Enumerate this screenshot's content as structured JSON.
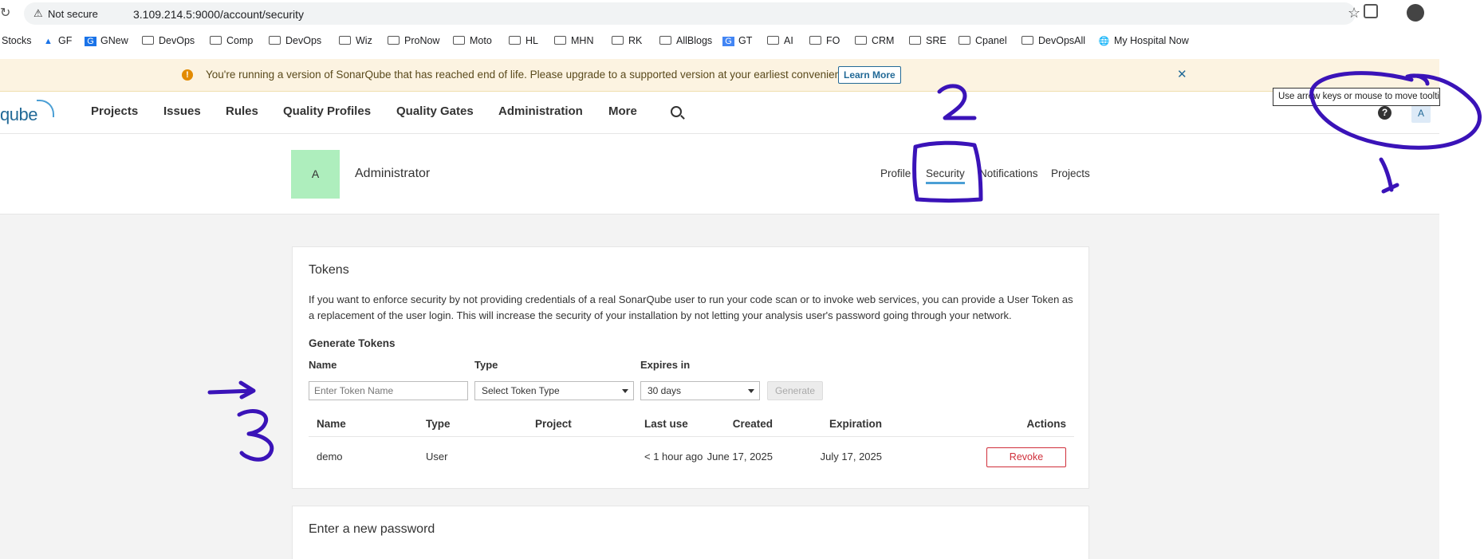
{
  "browser": {
    "not_secure": "Not secure",
    "url": "3.109.214.5:9000/account/security",
    "bookmarks": [
      {
        "label": "Stocks",
        "icon": "none"
      },
      {
        "label": "GF",
        "icon": "drive-icon"
      },
      {
        "label": "GNew",
        "icon": "news-icon"
      },
      {
        "label": "DevOps",
        "icon": "folder-icon"
      },
      {
        "label": "Comp",
        "icon": "folder-icon"
      },
      {
        "label": "DevOps",
        "icon": "folder-icon"
      },
      {
        "label": "Wiz",
        "icon": "folder-icon"
      },
      {
        "label": "ProNow",
        "icon": "folder-icon"
      },
      {
        "label": "Moto",
        "icon": "folder-icon"
      },
      {
        "label": "HL",
        "icon": "folder-icon"
      },
      {
        "label": "MHN",
        "icon": "folder-icon"
      },
      {
        "label": "RK",
        "icon": "folder-icon"
      },
      {
        "label": "AllBlogs",
        "icon": "folder-icon"
      },
      {
        "label": "GT",
        "icon": "translate-icon"
      },
      {
        "label": "AI",
        "icon": "folder-icon"
      },
      {
        "label": "FO",
        "icon": "folder-icon"
      },
      {
        "label": "CRM",
        "icon": "folder-icon"
      },
      {
        "label": "SRE",
        "icon": "folder-icon"
      },
      {
        "label": "Cpanel",
        "icon": "folder-icon"
      },
      {
        "label": "DevOpsAll",
        "icon": "folder-icon"
      },
      {
        "label": "My Hospital Now",
        "icon": "globe-icon"
      }
    ]
  },
  "banner": {
    "message": "You're running a version of SonarQube that has reached end of life. Please upgrade to a supported version at your earliest convenience.",
    "learn_more": "Learn More",
    "color": "#fcf3e1"
  },
  "nav": {
    "logo": "qube",
    "items": [
      "Projects",
      "Issues",
      "Rules",
      "Quality Profiles",
      "Quality Gates",
      "Administration",
      "More"
    ],
    "avatar_letter": "A",
    "tooltip": "Use arrow keys or mouse to move tooltip"
  },
  "account": {
    "avatar_letter": "A",
    "name": "Administrator",
    "tabs": [
      "Profile",
      "Security",
      "Notifications",
      "Projects"
    ],
    "active_tab": "Security"
  },
  "tokens": {
    "title": "Tokens",
    "description": "If you want to enforce security by not providing credentials of a real SonarQube user to run your code scan or to invoke web services, you can provide a User Token as a replacement of the user login. This will increase the security of your installation by not letting your analysis user's password going through your network.",
    "generate_title": "Generate Tokens",
    "name_label": "Name",
    "type_label": "Type",
    "expires_label": "Expires in",
    "name_placeholder": "Enter Token Name",
    "type_value": "Select Token Type",
    "expires_value": "30 days",
    "generate_label": "Generate",
    "columns": [
      "Name",
      "Type",
      "Project",
      "Last use",
      "Created",
      "Expiration",
      "Actions"
    ],
    "rows": [
      {
        "name": "demo",
        "type": "User",
        "project": "",
        "last_use": "< 1 hour ago",
        "created": "June 17, 2025",
        "expiration": "July 17, 2025",
        "action": "Revoke"
      }
    ]
  },
  "password": {
    "title": "Enter a new password"
  },
  "annotations": {
    "labels": [
      "1",
      "2",
      "3"
    ],
    "color": "#3a13b8"
  }
}
